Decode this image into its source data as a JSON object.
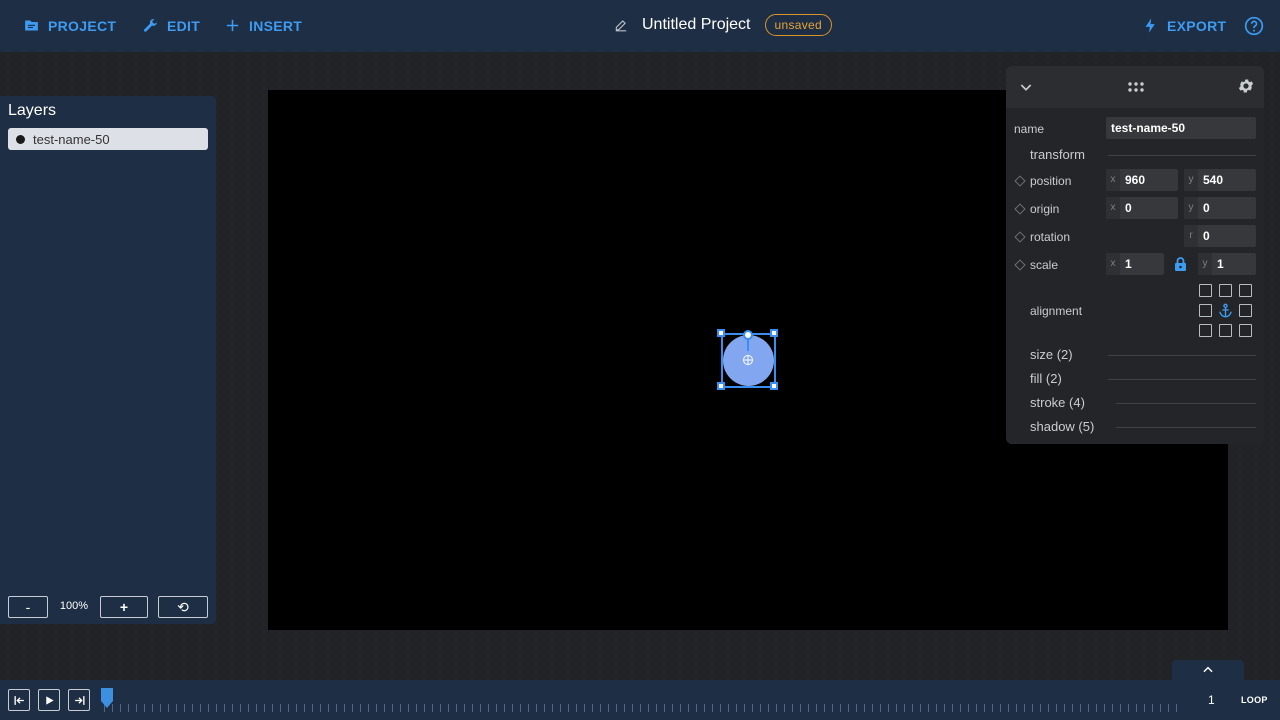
{
  "topbar": {
    "project_label": "PROJECT",
    "edit_label": "EDIT",
    "insert_label": "INSERT",
    "title": "Untitled Project",
    "status_badge": "unsaved",
    "export_label": "EXPORT"
  },
  "layers": {
    "heading": "Layers",
    "items": [
      {
        "label": "test-name-50"
      }
    ],
    "zoom_out_label": "-",
    "zoom_value": "100%",
    "zoom_in_label": "+",
    "reset_label": "⟲"
  },
  "properties": {
    "name_label": "name",
    "name_value": "test-name-50",
    "transform_label": "transform",
    "position": {
      "label": "position",
      "x_axis": "x",
      "x": "960",
      "y_axis": "y",
      "y": "540"
    },
    "origin": {
      "label": "origin",
      "x_axis": "x",
      "x": "0",
      "y_axis": "y",
      "y": "0"
    },
    "rotation": {
      "label": "rotation",
      "r_axis": "r",
      "r": "0"
    },
    "scale": {
      "label": "scale",
      "x_axis": "x",
      "x": "1",
      "y_axis": "y",
      "y": "1"
    },
    "alignment_label": "alignment",
    "sections": {
      "size": "size (2)",
      "fill": "fill (2)",
      "stroke": "stroke (4)",
      "shadow": "shadow (5)"
    }
  },
  "timeline": {
    "frame": "1",
    "loop_label": "LOOP"
  },
  "colors": {
    "accent": "#3d9bf2",
    "panel": "#1e2e44",
    "badge": "#e8a33a",
    "shape_fill": "#83a6f0"
  }
}
